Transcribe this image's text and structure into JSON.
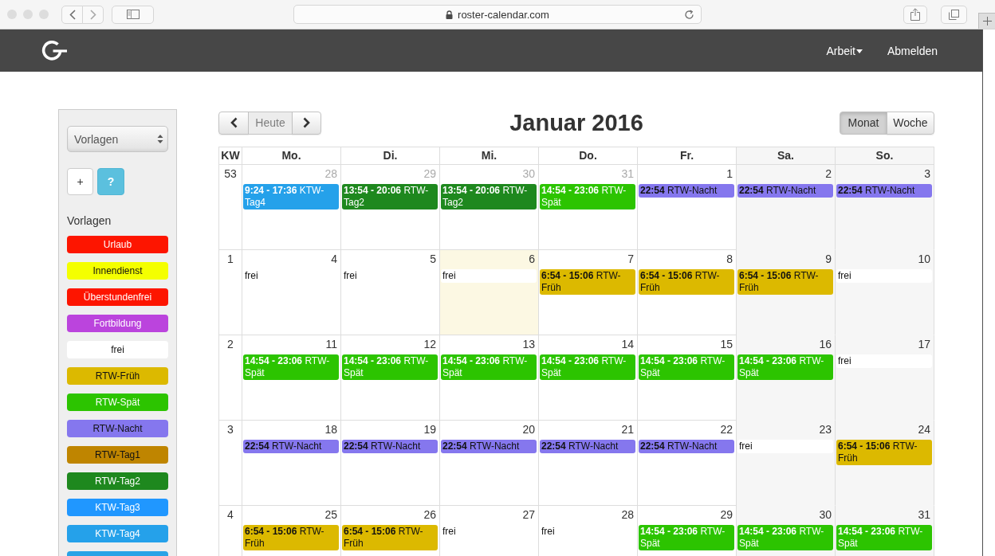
{
  "browser": {
    "url": "roster-calendar.com"
  },
  "navbar": {
    "menus": [
      {
        "label": "Arbeit",
        "kind": "dropdown"
      },
      {
        "label": "Abmelden",
        "kind": "link"
      }
    ]
  },
  "sidebar": {
    "select": {
      "value": "Vorlagen"
    },
    "buttons": [
      {
        "label": "+",
        "kind": "add"
      },
      {
        "label": "?",
        "kind": "help"
      }
    ],
    "heading": "Vorlagen",
    "templates": [
      {
        "label": "Urlaub",
        "color": "#fd1500"
      },
      {
        "label": "Innendienst",
        "color": "#f4ff00"
      },
      {
        "label": "Überstundenfrei",
        "color": "#fd1500"
      },
      {
        "label": "Fortbildung",
        "color": "#bb44dd"
      },
      {
        "label": "frei",
        "color": "#ffffff"
      },
      {
        "label": "RTW-Früh",
        "color": "#dcb900"
      },
      {
        "label": "RTW-Spät",
        "color": "#2cc400"
      },
      {
        "label": "RTW-Nacht",
        "color": "#8577ee"
      },
      {
        "label": "RTW-Tag1",
        "color": "#bf8500"
      },
      {
        "label": "RTW-Tag2",
        "color": "#1e881e"
      },
      {
        "label": "KTW-Tag3",
        "color": "#2097ff"
      },
      {
        "label": "KTW-Tag4",
        "color": "#25a1ea"
      },
      {
        "color": "#2aa3e6"
      }
    ]
  },
  "calendar": {
    "nav": [
      {
        "kind": "prev",
        "disabled": false
      },
      {
        "kind": "today",
        "label": "Heute",
        "disabled": true
      },
      {
        "kind": "next",
        "disabled": false
      }
    ],
    "title": "Januar 2016",
    "views": [
      {
        "label": "Monat",
        "selected": true
      },
      {
        "label": "Woche",
        "selected": false
      }
    ],
    "week_heading": "KW",
    "columns": [
      {
        "label": "Mo.",
        "weekend": false
      },
      {
        "label": "Di.",
        "weekend": false
      },
      {
        "label": "Mi.",
        "weekend": false
      },
      {
        "label": "Do.",
        "weekend": false
      },
      {
        "label": "Fr.",
        "weekend": false
      },
      {
        "label": "Sa.",
        "weekend": true
      },
      {
        "label": "So.",
        "weekend": true
      }
    ],
    "weeks": [
      {
        "week": "53",
        "days": [
          {
            "date": "28",
            "other_month": true,
            "today": false,
            "events": [
              {
                "time": "9:24 - 17:36",
                "title": "KTW-Tag4",
                "color": "#25a1ea"
              }
            ]
          },
          {
            "date": "29",
            "other_month": true,
            "today": false,
            "events": [
              {
                "time": "13:54 - 20:06",
                "title": "RTW-Tag2",
                "color": "#1e881e"
              }
            ]
          },
          {
            "date": "30",
            "other_month": true,
            "today": false,
            "events": [
              {
                "time": "13:54 - 20:06",
                "title": "RTW-Tag2",
                "color": "#1e881e"
              }
            ]
          },
          {
            "date": "31",
            "other_month": true,
            "today": false,
            "events": [
              {
                "time": "14:54 - 23:06",
                "title": "RTW-Spät",
                "color": "#2cc400"
              }
            ]
          },
          {
            "date": "1",
            "other_month": false,
            "today": false,
            "events": [
              {
                "time": "22:54",
                "title": "RTW-Nacht",
                "color": "#8577ee"
              }
            ]
          },
          {
            "date": "2",
            "other_month": false,
            "today": false,
            "events": [
              {
                "time": "22:54",
                "title": "RTW-Nacht",
                "color": "#8577ee"
              }
            ]
          },
          {
            "date": "3",
            "other_month": false,
            "today": false,
            "events": [
              {
                "time": "22:54",
                "title": "RTW-Nacht",
                "color": "#8577ee"
              }
            ]
          }
        ]
      },
      {
        "week": "1",
        "days": [
          {
            "date": "4",
            "other_month": false,
            "today": false,
            "events": [
              {
                "title": "frei",
                "color": "#ffffff"
              }
            ]
          },
          {
            "date": "5",
            "other_month": false,
            "today": false,
            "events": [
              {
                "title": "frei",
                "color": "#ffffff"
              }
            ]
          },
          {
            "date": "6",
            "other_month": false,
            "today": true,
            "events": [
              {
                "title": "frei",
                "color": "#ffffff"
              }
            ]
          },
          {
            "date": "7",
            "other_month": false,
            "today": false,
            "events": [
              {
                "time": "6:54 - 15:06",
                "title": "RTW-Früh",
                "color": "#dcb900"
              }
            ]
          },
          {
            "date": "8",
            "other_month": false,
            "today": false,
            "events": [
              {
                "time": "6:54 - 15:06",
                "title": "RTW-Früh",
                "color": "#dcb900"
              }
            ]
          },
          {
            "date": "9",
            "other_month": false,
            "today": false,
            "events": [
              {
                "time": "6:54 - 15:06",
                "title": "RTW-Früh",
                "color": "#dcb900"
              }
            ]
          },
          {
            "date": "10",
            "other_month": false,
            "today": false,
            "events": [
              {
                "title": "frei",
                "color": "#ffffff"
              }
            ]
          }
        ]
      },
      {
        "week": "2",
        "days": [
          {
            "date": "11",
            "other_month": false,
            "today": false,
            "events": [
              {
                "time": "14:54 - 23:06",
                "title": "RTW-Spät",
                "color": "#2cc400"
              }
            ]
          },
          {
            "date": "12",
            "other_month": false,
            "today": false,
            "events": [
              {
                "time": "14:54 - 23:06",
                "title": "RTW-Spät",
                "color": "#2cc400"
              }
            ]
          },
          {
            "date": "13",
            "other_month": false,
            "today": false,
            "events": [
              {
                "time": "14:54 - 23:06",
                "title": "RTW-Spät",
                "color": "#2cc400"
              }
            ]
          },
          {
            "date": "14",
            "other_month": false,
            "today": false,
            "events": [
              {
                "time": "14:54 - 23:06",
                "title": "RTW-Spät",
                "color": "#2cc400"
              }
            ]
          },
          {
            "date": "15",
            "other_month": false,
            "today": false,
            "events": [
              {
                "time": "14:54 - 23:06",
                "title": "RTW-Spät",
                "color": "#2cc400"
              }
            ]
          },
          {
            "date": "16",
            "other_month": false,
            "today": false,
            "events": [
              {
                "time": "14:54 - 23:06",
                "title": "RTW-Spät",
                "color": "#2cc400"
              }
            ]
          },
          {
            "date": "17",
            "other_month": false,
            "today": false,
            "events": [
              {
                "title": "frei",
                "color": "#ffffff"
              }
            ]
          }
        ]
      },
      {
        "week": "3",
        "days": [
          {
            "date": "18",
            "other_month": false,
            "today": false,
            "events": [
              {
                "time": "22:54",
                "title": "RTW-Nacht",
                "color": "#8577ee"
              }
            ]
          },
          {
            "date": "19",
            "other_month": false,
            "today": false,
            "events": [
              {
                "time": "22:54",
                "title": "RTW-Nacht",
                "color": "#8577ee"
              }
            ]
          },
          {
            "date": "20",
            "other_month": false,
            "today": false,
            "events": [
              {
                "time": "22:54",
                "title": "RTW-Nacht",
                "color": "#8577ee"
              }
            ]
          },
          {
            "date": "21",
            "other_month": false,
            "today": false,
            "events": [
              {
                "time": "22:54",
                "title": "RTW-Nacht",
                "color": "#8577ee"
              }
            ]
          },
          {
            "date": "22",
            "other_month": false,
            "today": false,
            "events": [
              {
                "time": "22:54",
                "title": "RTW-Nacht",
                "color": "#8577ee"
              }
            ]
          },
          {
            "date": "23",
            "other_month": false,
            "today": false,
            "events": [
              {
                "title": "frei",
                "color": "#ffffff"
              }
            ]
          },
          {
            "date": "24",
            "other_month": false,
            "today": false,
            "events": [
              {
                "time": "6:54 - 15:06",
                "title": "RTW-Früh",
                "color": "#dcb900"
              }
            ]
          }
        ]
      },
      {
        "week": "4",
        "days": [
          {
            "date": "25",
            "other_month": false,
            "today": false,
            "events": [
              {
                "time": "6:54 - 15:06",
                "title": "RTW-Früh",
                "color": "#dcb900"
              }
            ]
          },
          {
            "date": "26",
            "other_month": false,
            "today": false,
            "events": [
              {
                "time": "6:54 - 15:06",
                "title": "RTW-Früh",
                "color": "#dcb900"
              }
            ]
          },
          {
            "date": "27",
            "other_month": false,
            "today": false,
            "events": [
              {
                "title": "frei",
                "color": "#ffffff"
              }
            ]
          },
          {
            "date": "28",
            "other_month": false,
            "today": false,
            "events": [
              {
                "title": "frei",
                "color": "#ffffff"
              }
            ]
          },
          {
            "date": "29",
            "other_month": false,
            "today": false,
            "events": [
              {
                "time": "14:54 - 23:06",
                "title": "RTW-Spät",
                "color": "#2cc400"
              }
            ]
          },
          {
            "date": "30",
            "other_month": false,
            "today": false,
            "events": [
              {
                "time": "14:54 - 23:06",
                "title": "RTW-Spät",
                "color": "#2cc400"
              }
            ]
          },
          {
            "date": "31",
            "other_month": false,
            "today": false,
            "events": [
              {
                "time": "14:54 - 23:06",
                "title": "RTW-Spät",
                "color": "#2cc400"
              }
            ]
          }
        ]
      }
    ]
  }
}
